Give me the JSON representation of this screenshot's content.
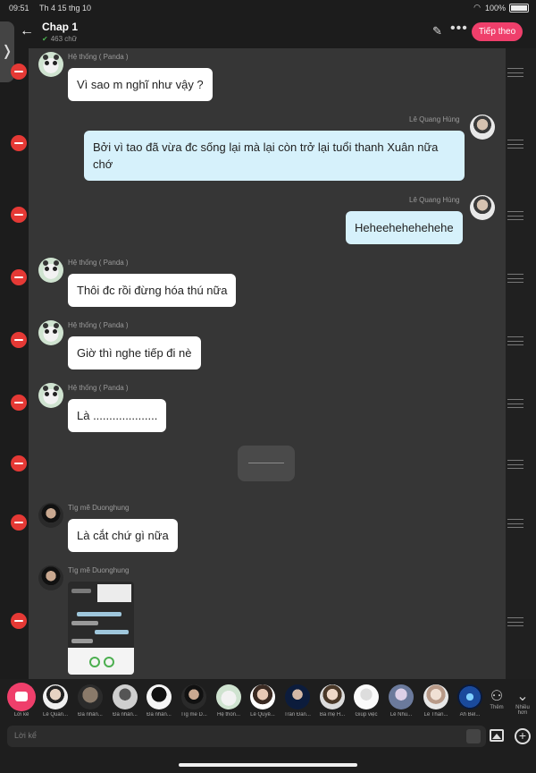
{
  "status_bar": {
    "time": "09:51",
    "date": "Th 4 15 thg 10",
    "battery": "100%"
  },
  "header": {
    "title": "Chap 1",
    "word_count": "463 chữ",
    "next_button": "Tiếp theo"
  },
  "messages": [
    {
      "sender": "Hệ thống ( Panda )",
      "text": "Vì sao m nghĩ như vậy ?"
    },
    {
      "sender": "Lê Quang Hùng",
      "text": "Bởi vì tao đã vừa đc sống lại mà lại còn trở lại tuổi thanh Xuân nữa chớ"
    },
    {
      "sender": "Lê Quang Hùng",
      "text": "Heheehehehehehe"
    },
    {
      "sender": "Hệ thống ( Panda )",
      "text": "Thôi đc rồi đừng hóa thú nữa"
    },
    {
      "sender": "Hệ thống ( Panda )",
      "text": "Giờ thì nghe tiếp đi nè"
    },
    {
      "sender": "Hệ thống ( Panda )",
      "text": "Là ...................."
    },
    {
      "sender": "Tìg mẽ Duonghung",
      "text": "Là cắt chứ gì nữa"
    },
    {
      "sender": "Tìg mẽ Duonghung",
      "text": ""
    }
  ],
  "characters": [
    {
      "name": "Lời kể"
    },
    {
      "name": "Lê Quan..."
    },
    {
      "name": "Đa nhân..."
    },
    {
      "name": "Đa nhân..."
    },
    {
      "name": "Đa nhân..."
    },
    {
      "name": "Tìg mẽ D..."
    },
    {
      "name": "Hệ thốn..."
    },
    {
      "name": "Lê Quyể..."
    },
    {
      "name": "Trần Đăn..."
    },
    {
      "name": "Ba mẹ H..."
    },
    {
      "name": "Giúp việc"
    },
    {
      "name": "Lê Nhu..."
    },
    {
      "name": "Lê Than..."
    },
    {
      "name": "Ah Bel..."
    }
  ],
  "more_labels": {
    "add": "Thêm",
    "more": "Nhiều hơn"
  },
  "input": {
    "placeholder": "Lời kể"
  }
}
